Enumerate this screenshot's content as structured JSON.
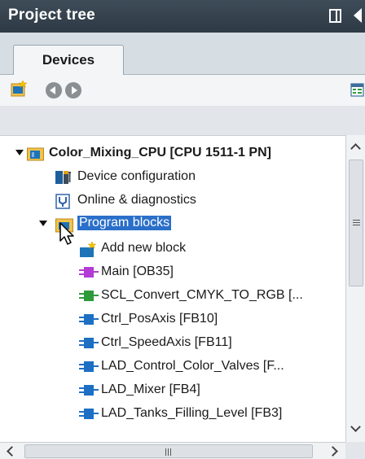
{
  "window": {
    "title": "Project tree"
  },
  "tabs": [
    {
      "label": "Devices",
      "active": true
    }
  ],
  "toolbar": {
    "icons": [
      "new-device-icon",
      "back-icon",
      "forward-icon",
      "overview-icon"
    ]
  },
  "tree": {
    "items": [
      {
        "label": "Color_Mixing_CPU [CPU 1511-1 PN]",
        "icon": "cpu-folder-icon",
        "expanded": true,
        "level": 0
      },
      {
        "label": "Device configuration",
        "icon": "device-configuration-icon",
        "level": 1
      },
      {
        "label": "Online & diagnostics",
        "icon": "online-diagnostics-icon",
        "level": 1
      },
      {
        "label": "Program blocks",
        "icon": "program-blocks-folder-icon",
        "expanded": true,
        "selected": true,
        "level": 1
      },
      {
        "label": "Add new block",
        "icon": "add-block-icon",
        "level": 2
      },
      {
        "label": "Main [OB35]",
        "icon": "ob-block-icon",
        "color": "#b33bd6",
        "level": 2
      },
      {
        "label": "SCL_Convert_CMYK_TO_RGB [...",
        "icon": "fc-block-icon",
        "color": "#2e9b3a",
        "level": 2
      },
      {
        "label": "Ctrl_PosAxis [FB10]",
        "icon": "fb-block-icon",
        "color": "#1d6fc4",
        "level": 2
      },
      {
        "label": "Ctrl_SpeedAxis [FB11]",
        "icon": "fb-block-icon",
        "color": "#1d6fc4",
        "level": 2
      },
      {
        "label": "LAD_Control_Color_Valves [F...",
        "icon": "fb-block-icon",
        "color": "#1d6fc4",
        "level": 2
      },
      {
        "label": "LAD_Mixer [FB4]",
        "icon": "fb-block-icon",
        "color": "#1d6fc4",
        "level": 2
      },
      {
        "label": "LAD_Tanks_Filling_Level [FB3]",
        "icon": "fb-block-icon",
        "color": "#1d6fc4",
        "level": 2
      }
    ]
  },
  "colors": {
    "titlebar": "#34414d",
    "selection": "#2a6fc9",
    "tabstrip": "#d6dde3"
  }
}
